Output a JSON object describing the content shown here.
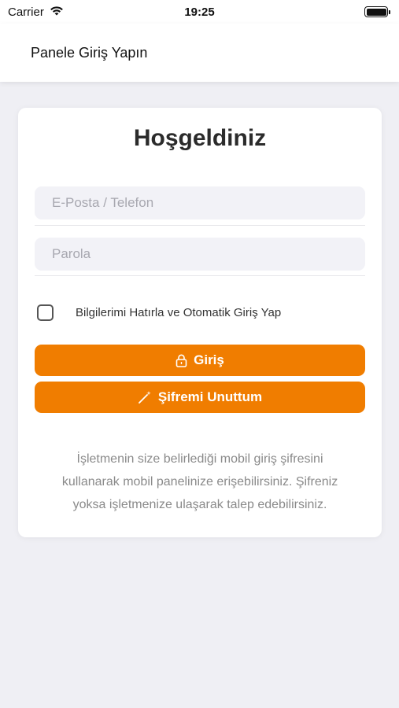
{
  "status_bar": {
    "carrier": "Carrier",
    "time": "19:25"
  },
  "nav": {
    "title": "Panele Giriş Yapın"
  },
  "login": {
    "welcome": "Hoşgeldiniz",
    "email_placeholder": "E-Posta / Telefon",
    "password_placeholder": "Parola",
    "remember_label": "Bilgilerimi Hatırla ve Otomatik Giriş Yap",
    "remember_checked": false,
    "login_button": "Giriş",
    "forgot_button": "Şifremi Unuttum",
    "info_text": "İşletmenin size belirlediği mobil giriş şifresini kullanarak mobil panelinize erişebilirsiniz. Şifreniz yoksa işletmenize ulaşarak talep edebilirsiniz."
  },
  "colors": {
    "accent": "#f07d00",
    "background": "#efeff4",
    "field_bg": "#f2f2f7"
  },
  "icons": {
    "login_button": "lock-icon",
    "forgot_button": "magic-wand-icon"
  }
}
